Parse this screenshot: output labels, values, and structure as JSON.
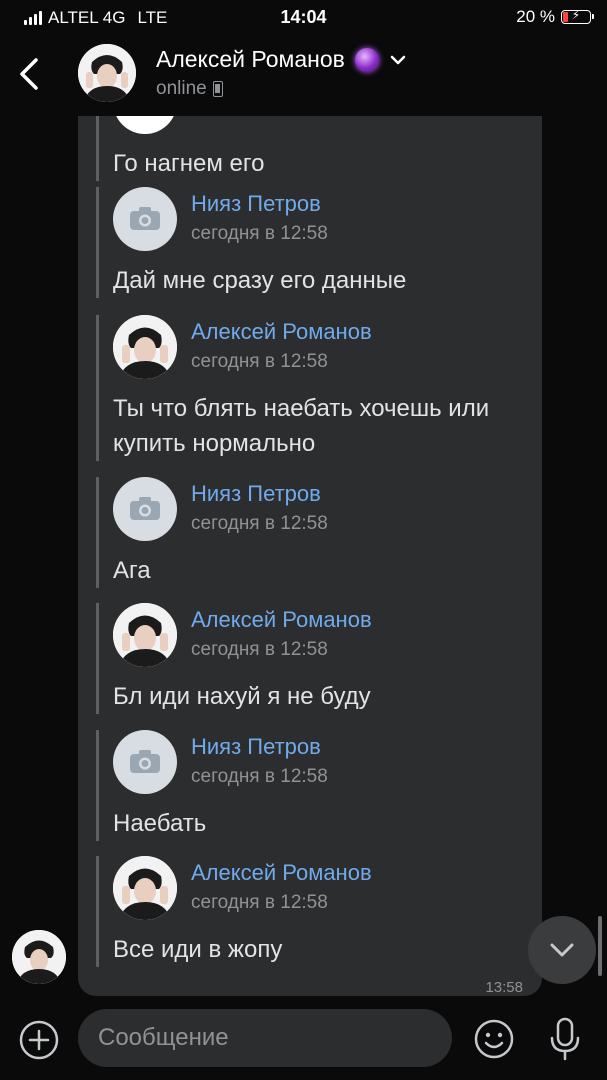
{
  "status_bar": {
    "carrier": "ALTEL 4G",
    "network": "LTE",
    "time": "14:04",
    "battery": "20 %"
  },
  "header": {
    "name": "Алексей Романов",
    "status": "online"
  },
  "messages": [
    {
      "author": "",
      "time": "",
      "text": "Го нагнем его"
    },
    {
      "author": "Нияз Петров",
      "time": "сегодня в 12:58",
      "text": "Дай мне сразу его данные"
    },
    {
      "author": "Алексей Романов",
      "time": "сегодня в 12:58",
      "text": "Ты что блять наебать хочешь или купить нормально"
    },
    {
      "author": "Нияз Петров",
      "time": "сегодня в 12:58",
      "text": "Ага"
    },
    {
      "author": "Алексей Романов",
      "time": "сегодня в 12:58",
      "text": "Бл иди нахуй я не буду"
    },
    {
      "author": "Нияз Петров",
      "time": "сегодня в 12:58",
      "text": "Наебать"
    },
    {
      "author": "Алексей Романов",
      "time": "сегодня в 12:58",
      "text": "Все иди в жопу"
    }
  ],
  "message_time": "13:58",
  "composer": {
    "placeholder": "Сообщение"
  },
  "colors": {
    "accent": "#71aaeb",
    "bubble": "#2c2d2e",
    "background": "#0a0a0a"
  }
}
